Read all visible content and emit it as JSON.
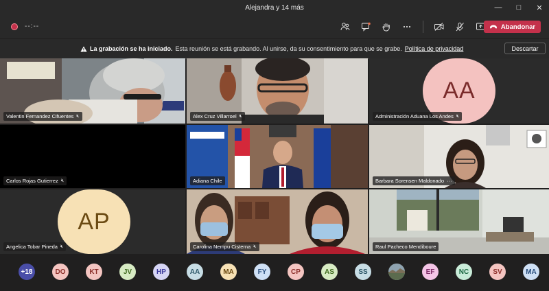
{
  "window": {
    "title": "Alejandra y 14 más"
  },
  "toolbar": {
    "timer": "--:--",
    "leave_label": "Abandonar"
  },
  "banner": {
    "title": "La grabación se ha iniciado.",
    "message": "Esta reunión se está grabando. Al unirse, da su consentimiento para que se grabe.",
    "link": "Política de privacidad",
    "dismiss_label": "Descartar"
  },
  "tiles": [
    {
      "name": "Valentin Fernandez Cifuentes",
      "muted": true
    },
    {
      "name": "Alex Cruz Villarroel",
      "muted": true
    },
    {
      "name": "Administración Aduana Los Andes",
      "muted": true,
      "initials": "AA"
    },
    {
      "name": "Carlos Rojas Gutierrez",
      "muted": true
    },
    {
      "name": "Adiana Chile",
      "muted": false
    },
    {
      "name": "Barbara Sorensen Maldonado",
      "muted": false,
      "extra": "···"
    },
    {
      "name": "Angelica Tobar Pineda",
      "muted": true,
      "initials": "AP"
    },
    {
      "name": "Carolina Nempu Cisterna",
      "muted": true
    },
    {
      "name": "Raul Pacheco Mendiboure",
      "muted": false
    }
  ],
  "colors": {
    "avatar_bg": "#f4c2c0",
    "avatar_text": "#7a2b2b",
    "ap_bg": "#f7e1b5",
    "ap_text": "#6b4a12",
    "leave": "#c4314b"
  },
  "strip": [
    {
      "label": "+18",
      "bg": "#4a4ea8",
      "fg": "#ffffff"
    },
    {
      "label": "DO",
      "bg": "#f4c5c1",
      "fg": "#8c2f2a"
    },
    {
      "label": "KT",
      "bg": "#f4c5c1",
      "fg": "#8c2f2a"
    },
    {
      "label": "JV",
      "bg": "#d7ebc3",
      "fg": "#3f6a1e"
    },
    {
      "label": "HP",
      "bg": "#d6d5f5",
      "fg": "#3d3b9c"
    },
    {
      "label": "AA",
      "bg": "#c7dde5",
      "fg": "#2a5566"
    },
    {
      "label": "MA",
      "bg": "#f7e1b5",
      "fg": "#6b4a12"
    },
    {
      "label": "FY",
      "bg": "#cfe0f5",
      "fg": "#2a4f7e"
    },
    {
      "label": "CP",
      "bg": "#f4c5c1",
      "fg": "#8c2f2a"
    },
    {
      "label": "AS",
      "bg": "#d7ebc3",
      "fg": "#3f6a1e"
    },
    {
      "label": "SS",
      "bg": "#c7dde5",
      "fg": "#2a5566"
    },
    {
      "label": "",
      "bg": "#5b6b4e",
      "fg": "#ffffff",
      "photo": true
    },
    {
      "label": "EF",
      "bg": "#f4c5e6",
      "fg": "#7e2a66"
    },
    {
      "label": "NC",
      "bg": "#c9ecd9",
      "fg": "#1f6a45"
    },
    {
      "label": "SV",
      "bg": "#f4c5c1",
      "fg": "#8c2f2a"
    },
    {
      "label": "MA",
      "bg": "#cfe0f5",
      "fg": "#2a4f7e"
    }
  ]
}
